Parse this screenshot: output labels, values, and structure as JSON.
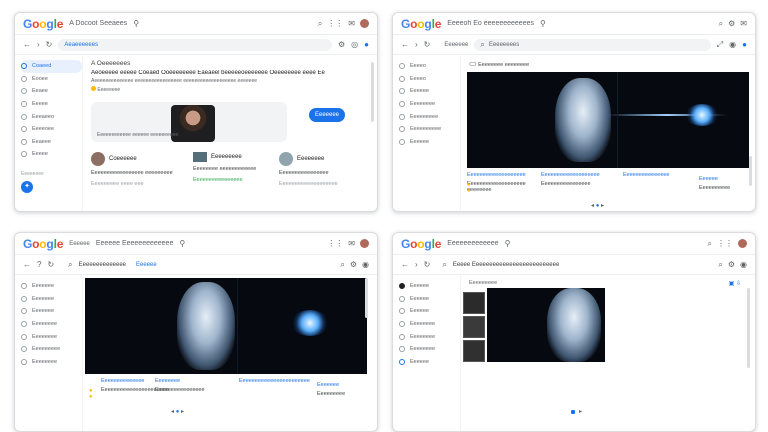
{
  "windows": [
    {
      "title": "A Docoot Seeaees",
      "search": "Aeaeeeeees",
      "sidebar": [
        "Coaeed",
        "Eooee",
        "Eeaee",
        "Eeeee",
        "Eeeaeeo",
        "Eeeeoee",
        "Eeaeee",
        "Eeeee"
      ],
      "sidebar_footer": "Eeeeeeee",
      "heading": "A Oeeeeeees",
      "headline": "Aeoeeeee eeeee Coeaed Ooeeeeeeee Eaeaeel beeeeeoeeeeeee Oeeeeeeee eeee Ee",
      "subline": "Aeeeeeeeeeeeeee eeeeeeeeeeeeeeeee eeeeeeeeeeeeeeeeeee eeeeeee",
      "byline": "Eeeeeeee",
      "hero_caption": "Eeeeeeeeeeee eeeeee eeeeeeeeee",
      "hero_button": "Eeeeeee",
      "cards": [
        {
          "title": "Coeeeeee",
          "text": "Eeeeeeeeeeeeeeeee eeeeeeeee",
          "meta": "Eeeeeeeee eeee eee"
        },
        {
          "title": "Eeeeeeeee",
          "text": "Eeeeeeee eeeeeeeeeeee",
          "meta": "Eeeeeeeeeeeeeeee"
        },
        {
          "title": "Eeeeeeee",
          "text": "Eeeeeeeeeeeeeeee",
          "meta": "Eeeeeeeeeeeeeeeeeee"
        }
      ]
    },
    {
      "title": "Eeeeoh Eo eeeeeeeeeeees",
      "search": "Eeeeeeees",
      "tab": "Eeeeeee",
      "sidebar": [
        "Eeeeo",
        "Eeeeo",
        "Eeeeee",
        "Eeeeeeee",
        "Eeeeeeeee",
        "Eeeeeeeeee",
        "Eeeeee"
      ],
      "media_title": "Eeeeeeee eeeeeeee",
      "captions": [
        {
          "title": "Eeeeeeeeeeeeeeeeeee",
          "text": "Eeeeeeeeeeeeeeeeeee eeeeeeee"
        },
        {
          "title": "Eeeeeeeeeeeeeeeeeee",
          "text": "Eeeeeeeeeeeeeeee"
        },
        {
          "title": "Eeeeeeeeeeeeeee",
          "text": ""
        },
        {
          "title": "Eeeeee",
          "text": "Eeeeeeeeee"
        }
      ]
    },
    {
      "title": "Eeeeee  Eeeeeeeeeeeee",
      "tab": "Eeeeee",
      "search": "Eeeeeeeeeeeeee",
      "toolbar_tag": "Eeeeee",
      "sidebar": [
        "Eeeeeee",
        "Eeeeeee",
        "Eeeeeee",
        "Eeeeeeee",
        "Eeeeeeee",
        "Eeeeeeeee",
        "Eeeeeeee"
      ],
      "captions": [
        {
          "title": "Eeeeeeeeeeeeee",
          "text": "Eeeeeeeeeeeeeeeeeeeeee"
        },
        {
          "title": "Eeeeeeee",
          "text": "Eeeeeeeeeeeeeeee"
        },
        {
          "title": "Eeeeeeeeeeeeeeeeeeeeeee",
          "text": ""
        },
        {
          "title": "Eeeeeee",
          "text": "Eeeeeeeee"
        }
      ]
    },
    {
      "title": "Eeeeeeeeeeeee",
      "search": "Eeeee Eeeeeeeeeeeeeeeeeeeeeeeeee",
      "sidebar": [
        "Eeeeee",
        "Eeeeee",
        "Eeeeee",
        "Eeeeeeee",
        "Eeeeeeee",
        "Eeeeeeee",
        "Eeeeee"
      ],
      "toolbar": "Eeeeeeeee"
    }
  ]
}
